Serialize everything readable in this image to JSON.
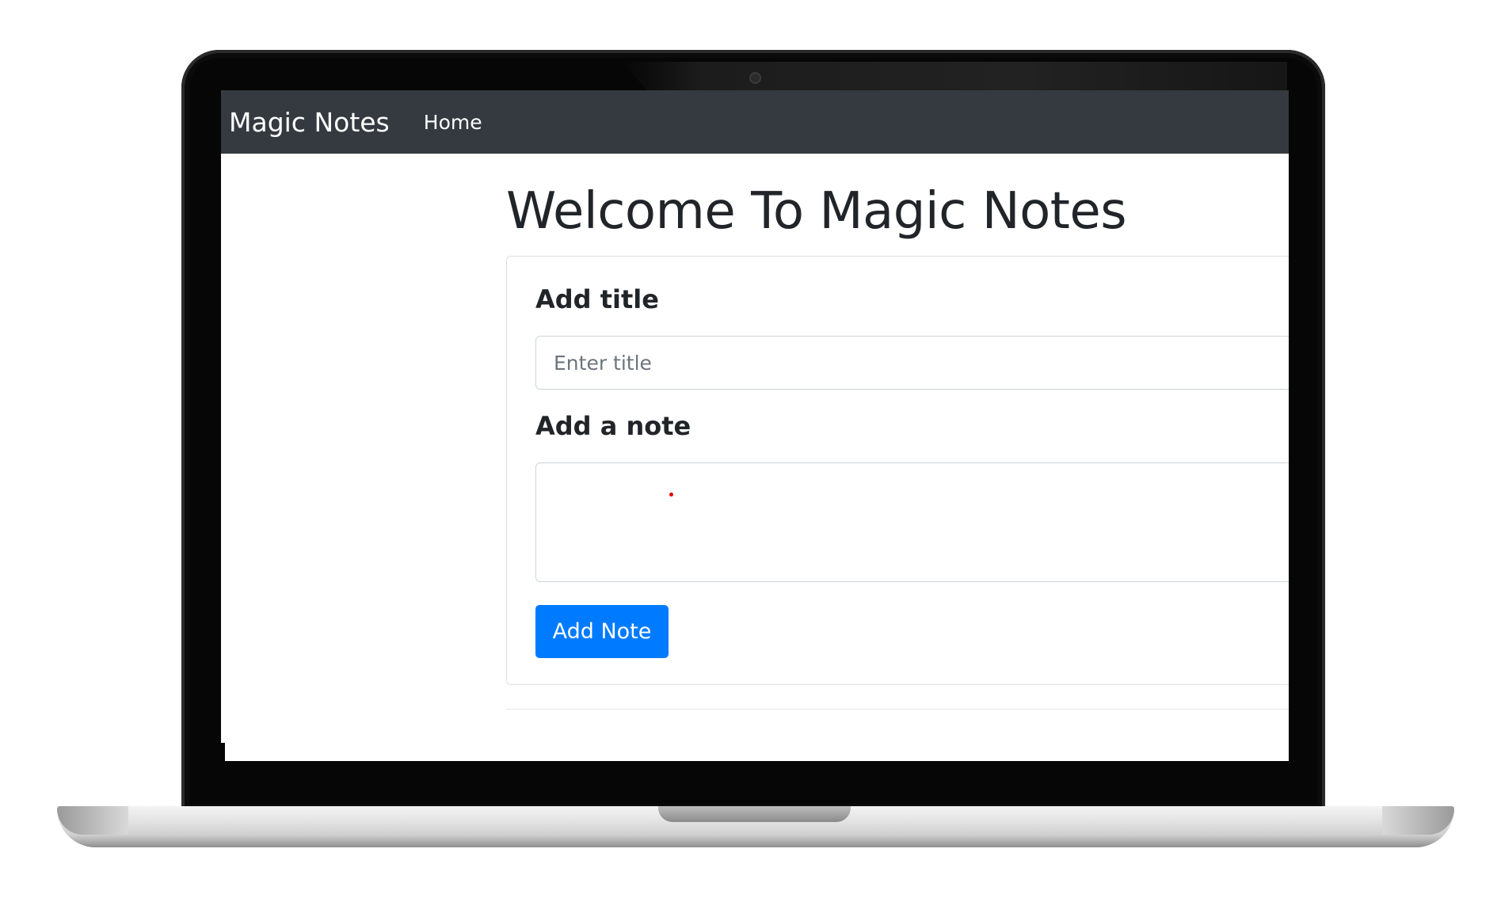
{
  "navbar": {
    "brand": "Magic Notes",
    "links": [
      {
        "label": "Home"
      }
    ]
  },
  "main": {
    "heading": "Welcome To Magic Notes",
    "form": {
      "title_label": "Add title",
      "title_placeholder": "Enter title",
      "title_value": "",
      "note_label": "Add a note",
      "note_value": "",
      "submit_label": "Add Note"
    }
  },
  "colors": {
    "navbar_bg": "#343a40",
    "primary": "#007bff",
    "text": "#212529"
  }
}
